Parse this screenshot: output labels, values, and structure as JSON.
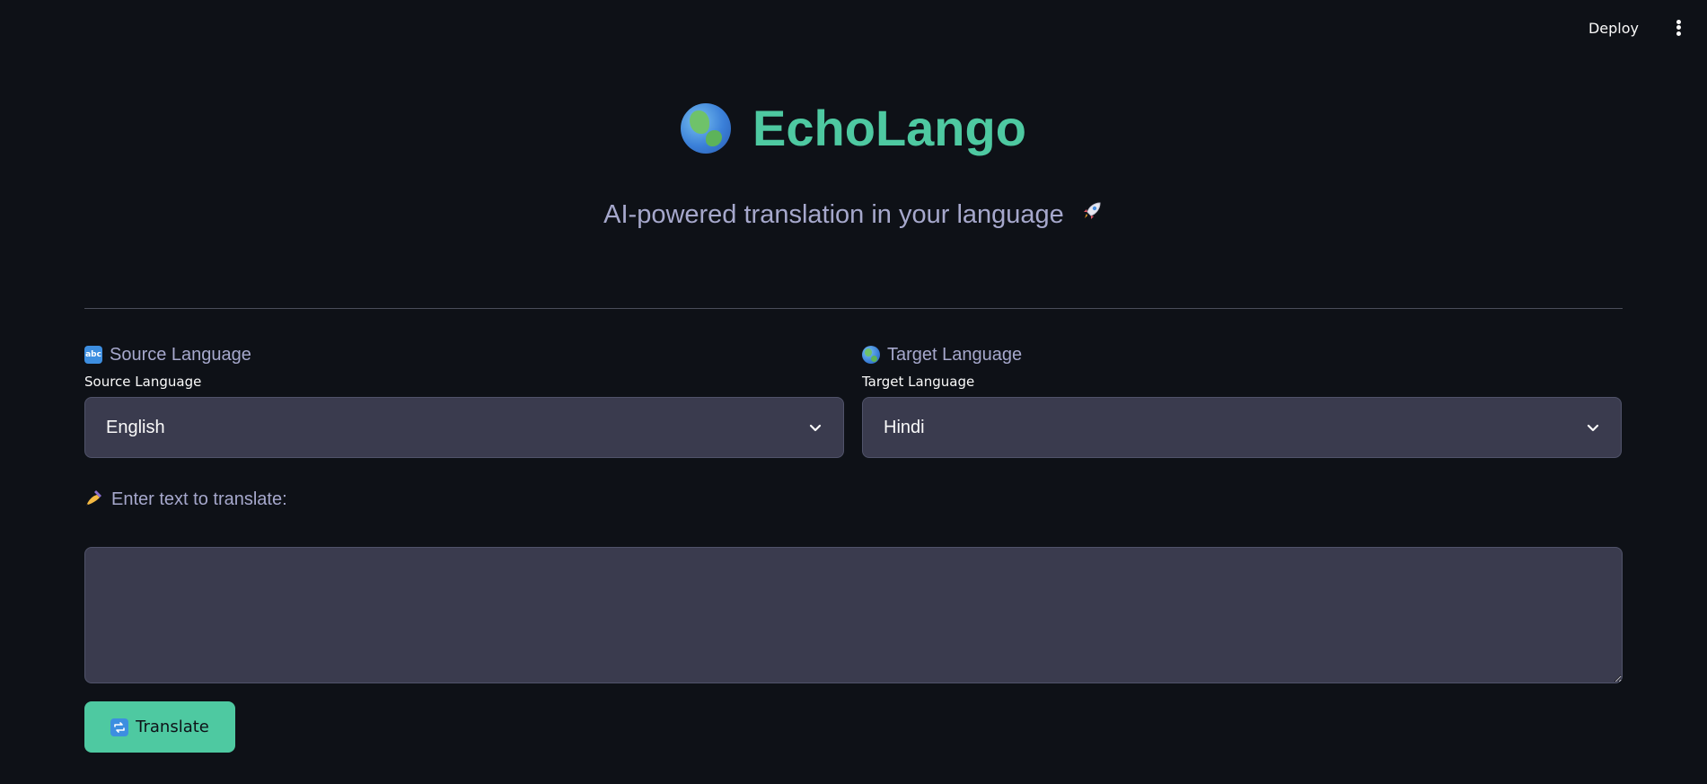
{
  "topbar": {
    "deploy_label": "Deploy",
    "menu_icon": "kebab-menu-icon"
  },
  "header": {
    "title": "EchoLango",
    "title_icon": "globe-icon",
    "subtitle": "AI-powered translation in your language",
    "subtitle_icon": "rocket-icon",
    "accent_color": "#4ec9a1",
    "background_color": "#0e1117"
  },
  "source": {
    "heading": "Source Language",
    "heading_icon": "abc-icon",
    "label": "Source Language",
    "selected": "English"
  },
  "target": {
    "heading": "Target Language",
    "heading_icon": "globe-icon",
    "label": "Target Language",
    "selected": "Hindi"
  },
  "input": {
    "prompt": "Enter text to translate:",
    "prompt_icon": "writing-hand-icon",
    "value": ""
  },
  "actions": {
    "translate_label": "Translate",
    "translate_icon": "repeat-icon"
  }
}
